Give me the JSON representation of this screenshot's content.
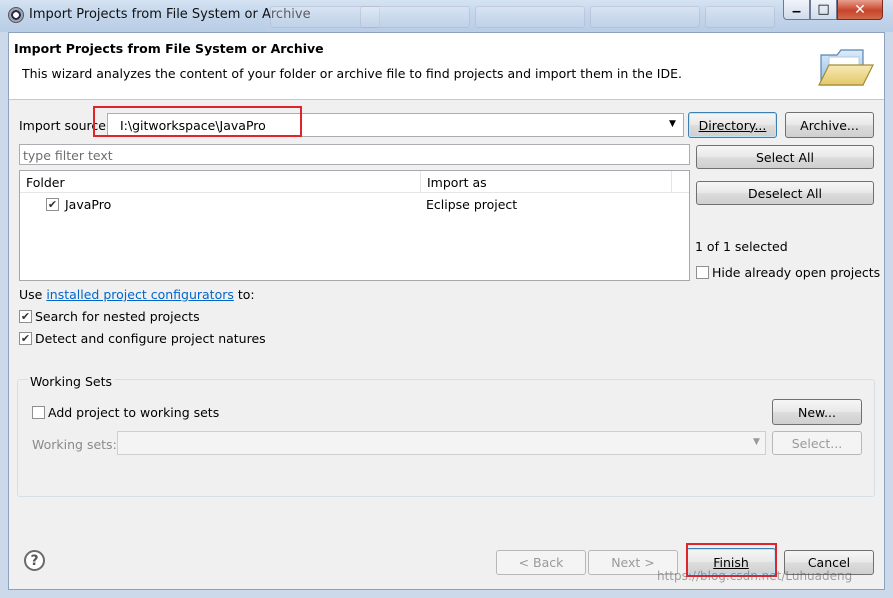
{
  "window": {
    "title": "Import Projects from File System or Archive",
    "close_glyph": "✕",
    "min_glyph": "▁",
    "max_glyph": "□"
  },
  "banner": {
    "title": "Import Projects from File System or Archive",
    "description": "This wizard analyzes the content of your folder or archive file to find projects and import them in the IDE.",
    "icon": "open-folder-icon"
  },
  "import_source": {
    "label": "Import source:",
    "value": "I:\\gitworkspace\\JavaPro",
    "directory_button": "Directory...",
    "archive_button": "Archive..."
  },
  "filter": {
    "placeholder": "type filter text"
  },
  "table": {
    "columns": [
      "Folder",
      "Import as"
    ],
    "rows": [
      {
        "folder": "JavaPro",
        "import_as": "Eclipse project",
        "checked": true
      }
    ]
  },
  "side": {
    "select_all": "Select All",
    "deselect_all": "Deselect All",
    "selection_status": "1 of 1 selected",
    "hide_open": "Hide already open projects"
  },
  "options": {
    "use_prefix": "Use ",
    "configurators_link": "installed project configurators",
    "use_suffix": " to:",
    "search_nested": "Search for nested projects",
    "detect_natures": "Detect and configure project natures"
  },
  "working_sets": {
    "group_label": "Working Sets",
    "add_to_sets": "Add project to working sets",
    "new_button": "New...",
    "sets_label": "Working sets:",
    "select_button": "Select..."
  },
  "footer": {
    "back": "< Back",
    "next": "Next >",
    "finish": "Finish",
    "cancel": "Cancel",
    "help_glyph": "?",
    "watermark": "https://blog.csdn.net/Luhuadeng"
  },
  "colors": {
    "highlight_box": "#e0242b",
    "link": "#0066cc"
  }
}
